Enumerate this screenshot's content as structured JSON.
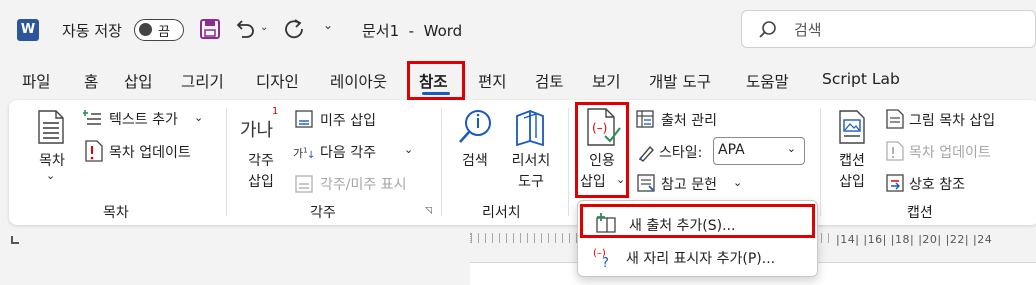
{
  "titlebar": {
    "app_icon": "W",
    "autosave_label": "자동 저장",
    "autosave_state": "끔",
    "document_title": "문서1  -  Word",
    "search_placeholder": "검색"
  },
  "tabs": [
    "파일",
    "홈",
    "삽입",
    "그리기",
    "디자인",
    "레이아웃",
    "참조",
    "편지",
    "검토",
    "보기",
    "개발 도구",
    "도움말",
    "Script Lab"
  ],
  "active_tab": "참조",
  "ribbon": {
    "toc": {
      "toc_button": [
        "목차"
      ],
      "add_text": "텍스트 추가",
      "update_table": "목차 업데이트",
      "group_label": "목차"
    },
    "footnotes": {
      "insert_footnote": [
        "각주",
        "삽입"
      ],
      "footnote_icon_text": "가나",
      "insert_endnote": "미주 삽입",
      "next_footnote": "다음 각주",
      "show_notes": "각주/미주 표시",
      "group_label": "각주"
    },
    "research": {
      "search": "검색",
      "researcher": [
        "리서치",
        "도구"
      ],
      "group_label": "리서치"
    },
    "citations": {
      "insert_citation": [
        "인용",
        "삽입"
      ],
      "manage_sources": "출처 관리",
      "style_label": "스타일:",
      "style_value": "APA",
      "bibliography": "참고 문헌"
    },
    "captions": {
      "insert_caption": [
        "캡션",
        "삽입"
      ],
      "insert_table_of_figures": "그림 목차 삽입",
      "update_table": "목차 업데이트",
      "cross_reference": "상호 참조",
      "group_label": "캡션"
    }
  },
  "ruler_text": "|14|  |16|  |18|  |20|  |22|  |24",
  "dropdown": {
    "items": [
      {
        "label": "새 출처 추가(S)..."
      },
      {
        "label": "새 자리 표시자 추가(P)..."
      }
    ]
  },
  "colors": {
    "highlight": "#e00000",
    "accent": "#185abd",
    "word_blue": "#2b579a",
    "save_purple": "#8b2d8e"
  }
}
